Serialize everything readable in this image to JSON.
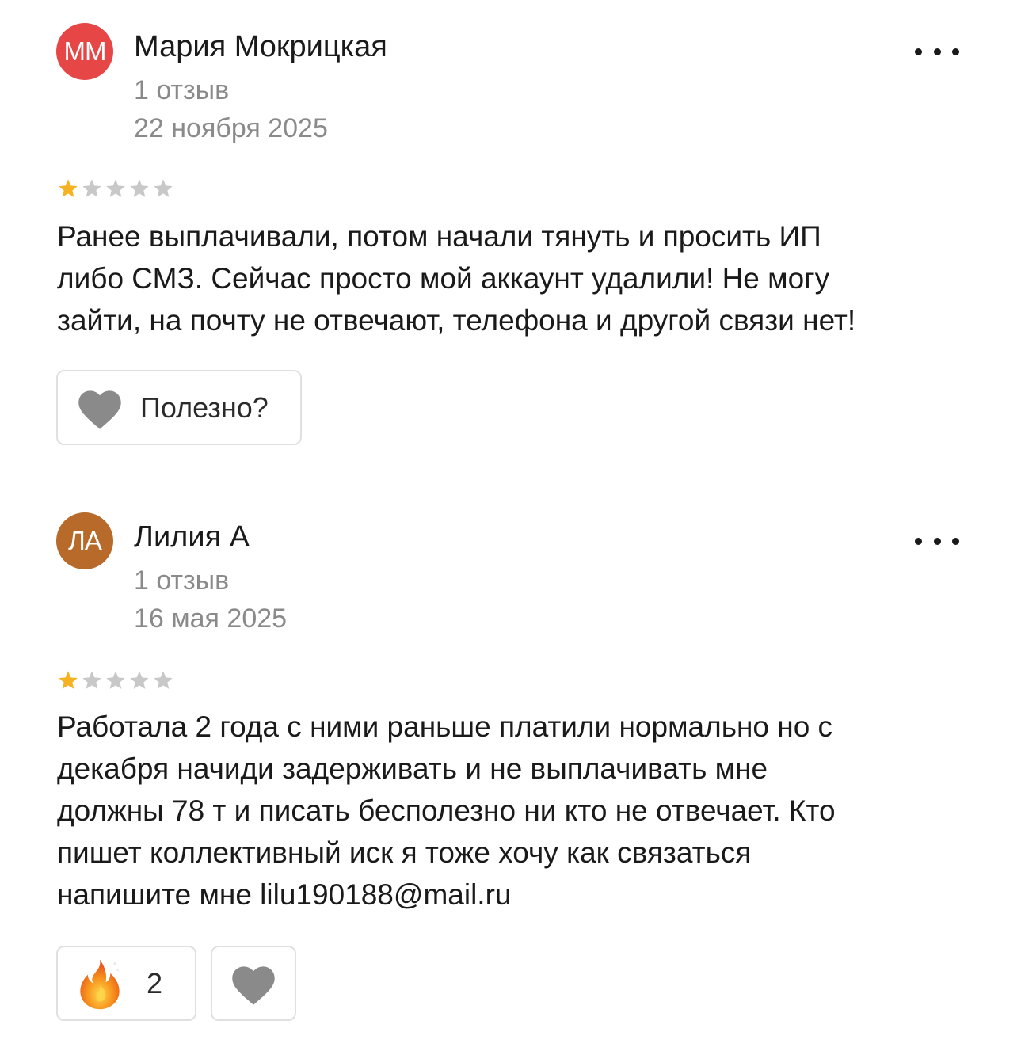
{
  "reviews": [
    {
      "avatar_initials": "ММ",
      "avatar_color": "#e64646",
      "author": "Мария Мокрицкая",
      "review_count": "1 отзыв",
      "date": "22 ноября 2025",
      "rating": 1,
      "text": "Ранее выплачивали, потом начали тянуть и просить ИП\nлибо СМЗ. Сейчас просто мой аккаунт удалили! Не могу\nзайти, на почту не отвечают, телефона и другой связи нет!",
      "helpful_label": "Полезно?"
    },
    {
      "avatar_initials": "ЛА",
      "avatar_color": "#b86a2a",
      "author": "Лилия А",
      "review_count": "1 отзыв",
      "date": "16 мая 2025",
      "rating": 1,
      "text": "Работала 2 года с ними раньше платили нормально но с\nдекабря начиди задерживать и не выплачивать мне\nдолжны 78 т и писать бесполезно ни кто не отвечает. Кто\nпишет коллективный иск я тоже хочу как связаться\nнапишите мне lilu190188@mail.ru",
      "fire_reaction_count": "2"
    }
  ],
  "colors": {
    "star_filled": "#f5b324",
    "star_empty": "#c8c8c8",
    "heart": "#8a8a8a",
    "fire": "#f2711c"
  },
  "icons": [
    "more-dots-icon",
    "star-icon",
    "heart-icon",
    "fire-emoji-icon"
  ]
}
